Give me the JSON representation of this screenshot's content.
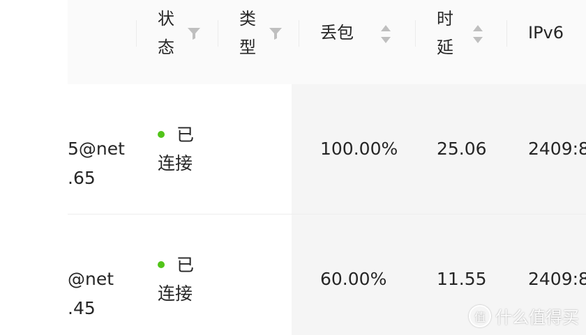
{
  "table": {
    "columns": {
      "status": {
        "line1": "状",
        "line2": "态",
        "icon": "filter-icon"
      },
      "type": {
        "line1": "类",
        "line2": "型",
        "icon": "filter-icon"
      },
      "packet_loss": {
        "label": "丢包",
        "icon": "sort-icon"
      },
      "latency": {
        "line1": "时",
        "line2": "延",
        "icon": "sort-icon"
      },
      "ipv6": {
        "label": "IPv6"
      }
    },
    "rows": [
      {
        "name_line1": "5@net",
        "name_line2": ".65",
        "status_line1": "已",
        "status_line2": "连接",
        "status_color": "#52c41a",
        "packet_loss": "100.00%",
        "latency": "25.06",
        "ipv6": "2409:8"
      },
      {
        "name_line1": "@net",
        "name_line2": ".45",
        "status_line1": "已",
        "status_line2": "连接",
        "status_color": "#52c41a",
        "packet_loss": "60.00%",
        "latency": "11.55",
        "ipv6": "2409:8"
      }
    ]
  },
  "watermark": {
    "text": "什么值得买",
    "logo": "值"
  }
}
